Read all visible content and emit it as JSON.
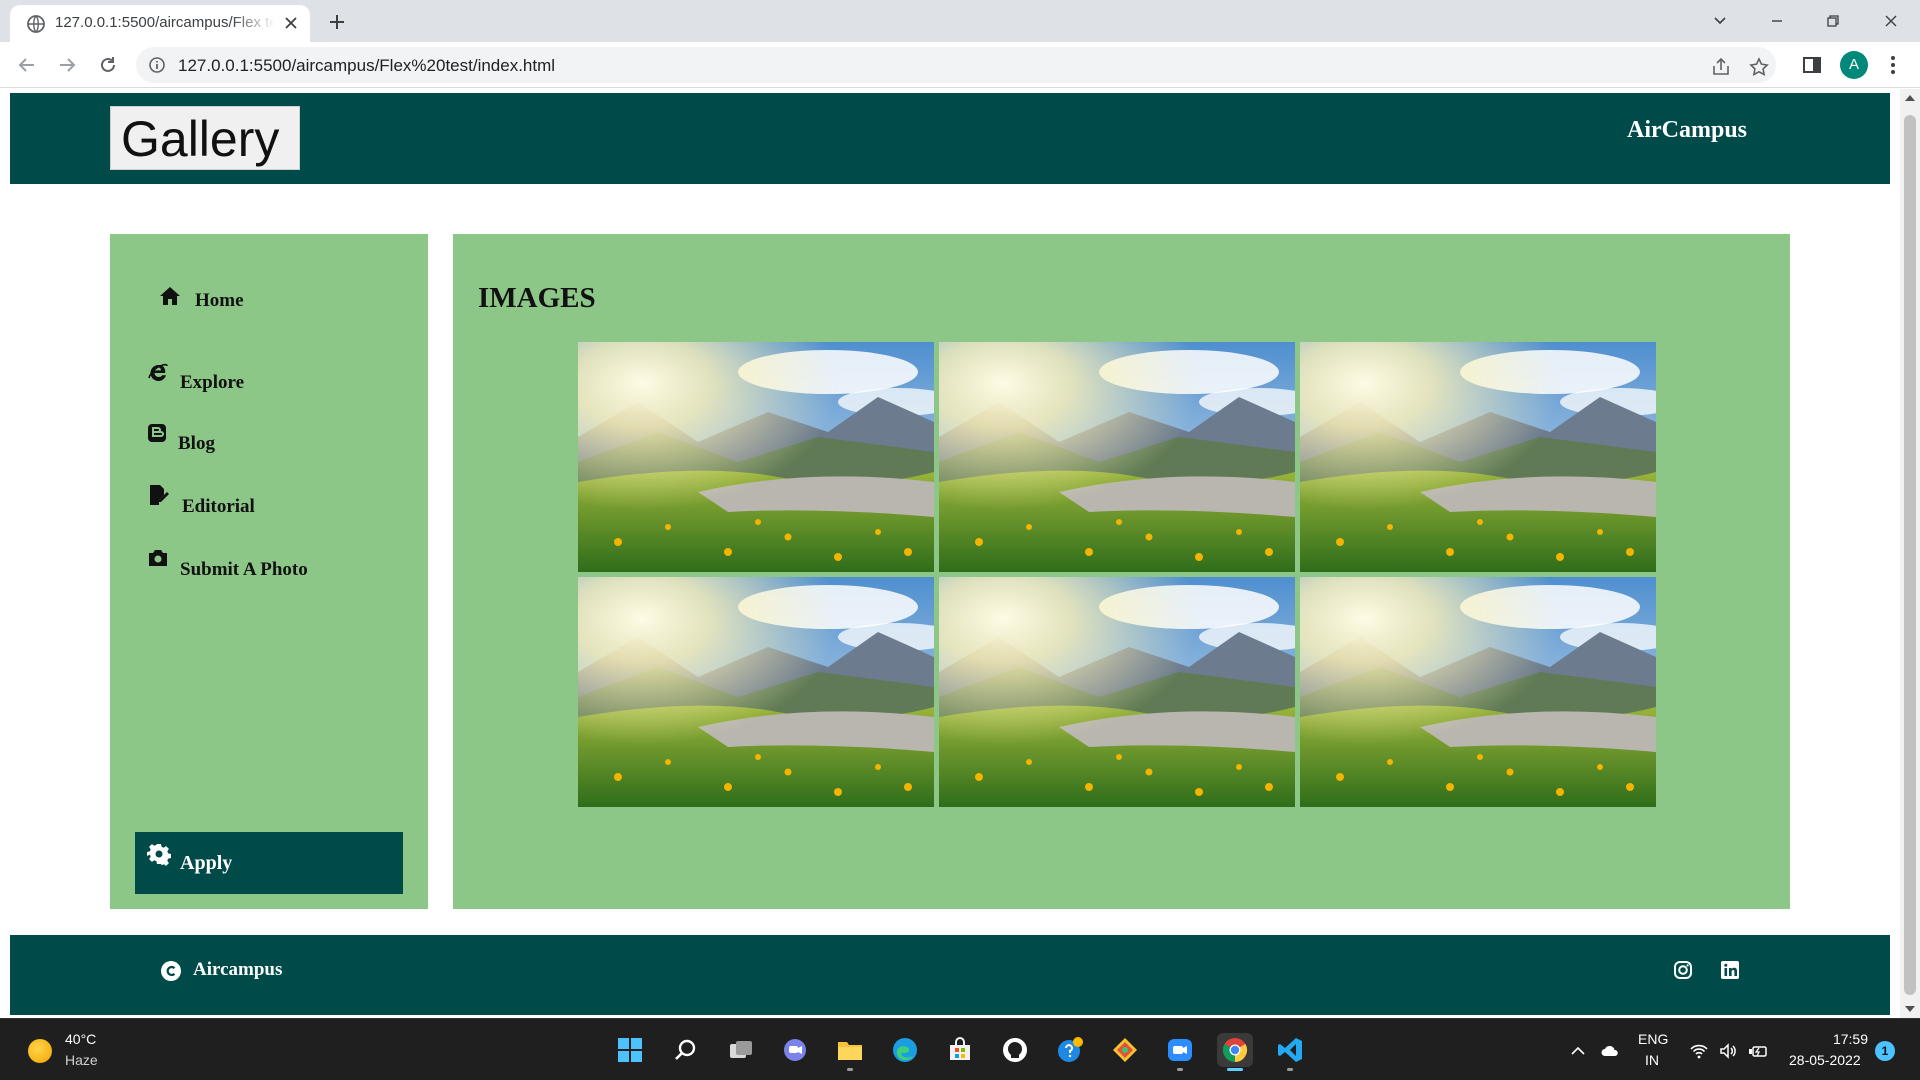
{
  "browser": {
    "tab_title": "127.0.0.1:5500/aircampus/Flex test/index.html",
    "url": "127.0.0.1:5500/aircampus/Flex%20test/index.html",
    "profile_initial": "A"
  },
  "header": {
    "logo": "Gallery",
    "brand": "AirCampus"
  },
  "sidebar": {
    "items": [
      {
        "label": "Home",
        "icon": "home-icon"
      },
      {
        "label": "Explore",
        "icon": "internet-explorer-icon"
      },
      {
        "label": "Blog",
        "icon": "blogger-icon"
      },
      {
        "label": "Editorial",
        "icon": "file-signature-icon"
      },
      {
        "label": "Submit A Photo",
        "icon": "camera-icon"
      }
    ],
    "apply_label": "Apply"
  },
  "main": {
    "heading": "IMAGES",
    "images": [
      {
        "alt": "mountain-meadow-photo"
      },
      {
        "alt": "mountain-meadow-photo"
      },
      {
        "alt": "mountain-meadow-photo"
      },
      {
        "alt": "mountain-meadow-photo"
      },
      {
        "alt": "mountain-meadow-photo"
      },
      {
        "alt": "mountain-meadow-photo"
      }
    ]
  },
  "footer": {
    "copyright": "Aircampus",
    "social": [
      "instagram-icon",
      "linkedin-icon"
    ]
  },
  "colors": {
    "header_bg": "#004a4a",
    "panel_bg": "#8cc788"
  },
  "taskbar": {
    "temperature": "40°C",
    "condition": "Haze",
    "lang_1": "ENG",
    "lang_2": "IN",
    "time": "17:59",
    "date": "28-05-2022",
    "notifications": "1"
  }
}
